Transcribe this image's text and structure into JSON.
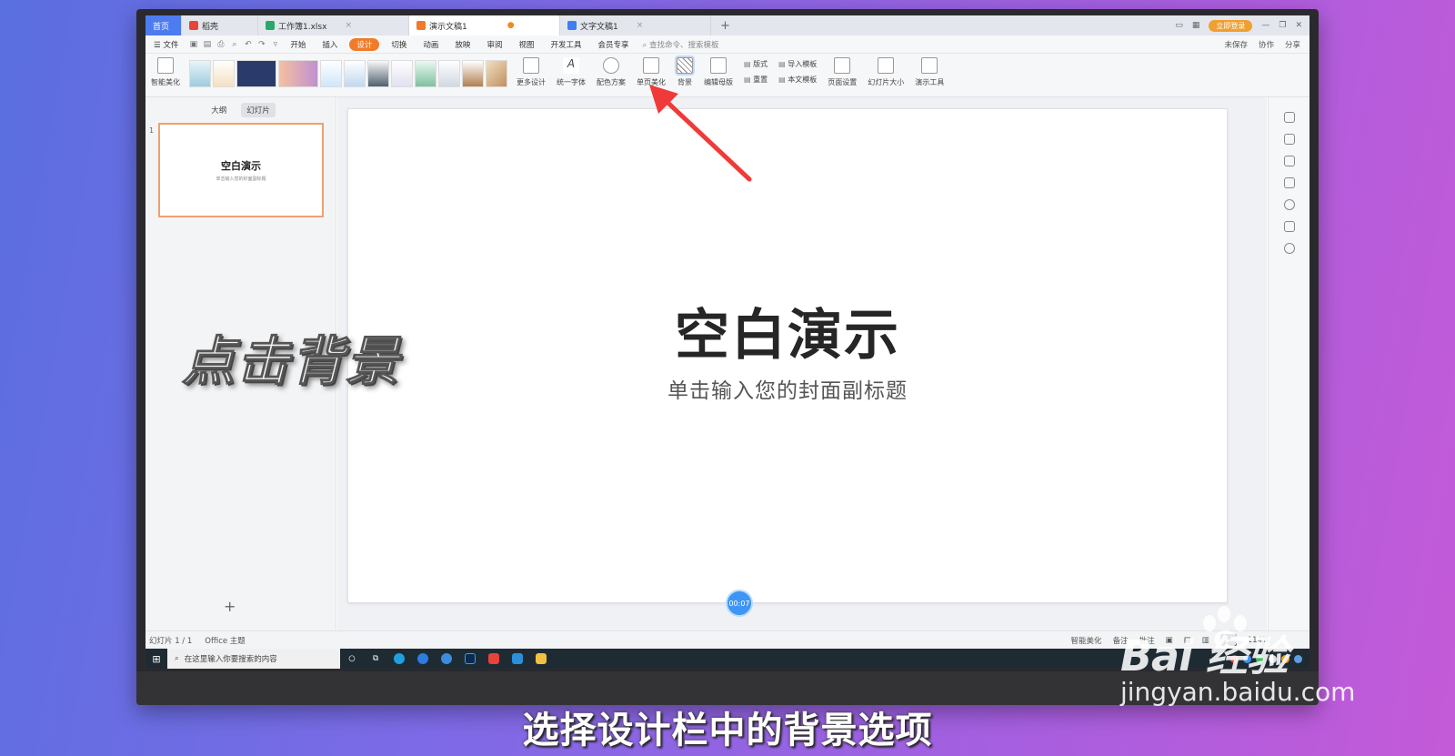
{
  "tabs": [
    {
      "label": "首页",
      "color": "#4d7cf0"
    },
    {
      "label": "稻壳",
      "color": "#e8433a"
    },
    {
      "label": "工作簿1.xlsx",
      "color": "#2aa86b"
    },
    {
      "label": "演示文稿1",
      "color": "#f07c2a"
    },
    {
      "label": "文字文稿1",
      "color": "#3f7ef0"
    }
  ],
  "tabbar": {
    "new_tab": "+",
    "login": "立即登录"
  },
  "menu": {
    "file": "文件",
    "items": [
      "开始",
      "插入",
      "设计",
      "切换",
      "动画",
      "放映",
      "审阅",
      "视图",
      "开发工具",
      "会员专享"
    ],
    "search_placeholder": "查找命令、搜索模板",
    "right": [
      "未保存",
      "协作",
      "分享"
    ]
  },
  "ribbon": {
    "smart_beautify": "智能美化",
    "more_design": "更多设计",
    "unify_font": "统一字体",
    "color_scheme": "配色方案",
    "single_page_beautify": "单页美化",
    "background": "背景",
    "edit_master": "编辑母版",
    "layout": "版式",
    "reset": "重置",
    "import_template": "导入模板",
    "this_template": "本文模板",
    "page_setup": "页面设置",
    "slide_size": "幻灯片大小",
    "presentation_tools": "演示工具"
  },
  "left_panel": {
    "tab_outline": "大纲",
    "tab_slides": "幻灯片",
    "slide_number": "1",
    "thumb_title": "空白演示",
    "thumb_subtitle": "单击输入您的封面副标题",
    "add": "+"
  },
  "slide": {
    "title": "空白演示",
    "subtitle": "单击输入您的封面副标题"
  },
  "timer": "00:07",
  "status": {
    "slide_count": "幻灯片 1 / 1",
    "theme": "Office 主题",
    "smart_beautify": "智能美化",
    "notes": "备注",
    "comments": "批注",
    "zoom": "114%"
  },
  "taskbar": {
    "search_placeholder": "在这里输入你要搜索的内容"
  },
  "overlay": {
    "caption": "点击背景",
    "subtitle": "选择设计栏中的背景选项"
  },
  "watermark": {
    "brand": "Bai 经验",
    "url": "jingyan.baidu.com"
  },
  "colors": {
    "accent": "#f07c2a",
    "arrow": "#f03a3a",
    "timer": "#3d96f5"
  }
}
